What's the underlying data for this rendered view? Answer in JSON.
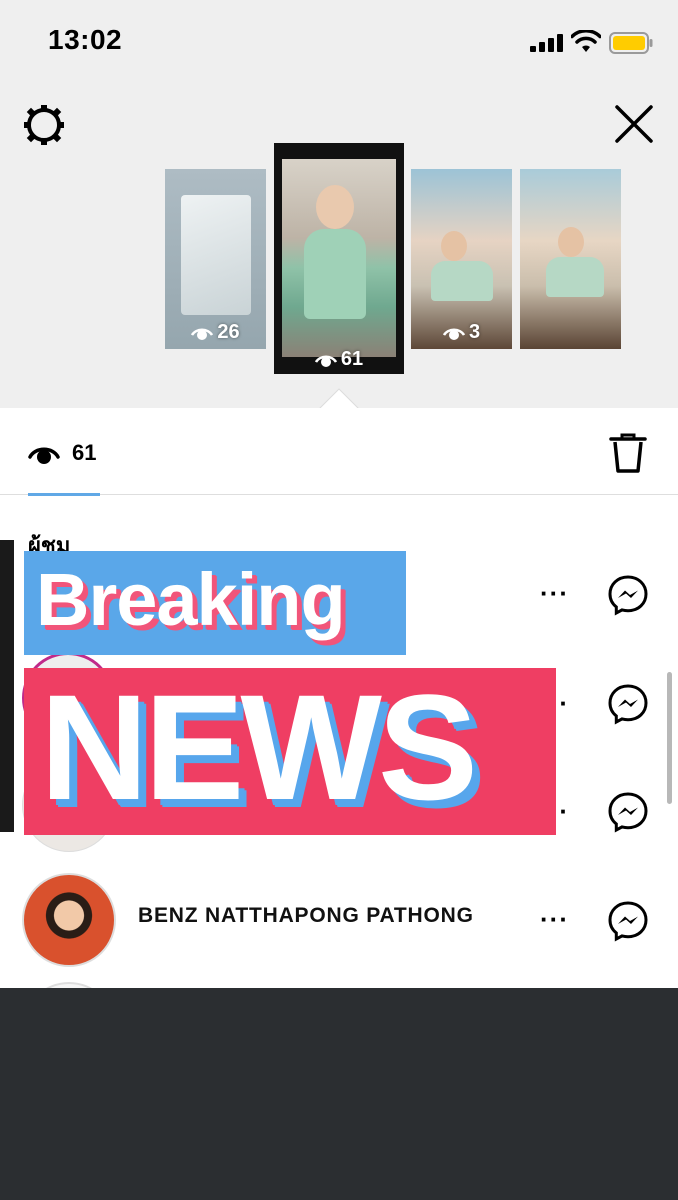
{
  "status_bar": {
    "time": "13:02",
    "battery_color": "#ffcc00"
  },
  "story_thumbnails": [
    {
      "views": "26",
      "selected": false
    },
    {
      "views": "61",
      "selected": true
    },
    {
      "views": "3",
      "selected": false
    },
    {
      "views": "",
      "selected": false
    }
  ],
  "header": {
    "view_count": "61",
    "icons": [
      "eye-icon",
      "trash-icon"
    ]
  },
  "viewers_section": {
    "label": "ผู้ชม",
    "visible_name": "BENZ NATTHAPONG PATHONG"
  },
  "overlay": {
    "line1": "Breaking",
    "line2": "NEWS",
    "colors": {
      "blue": "#5aa7e9",
      "pink": "#ef3e63"
    }
  }
}
